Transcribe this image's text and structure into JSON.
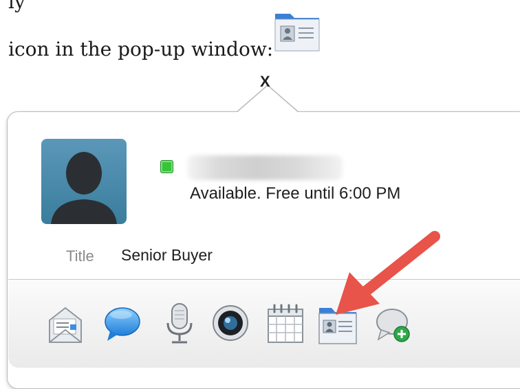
{
  "document": {
    "line1_text": "ly",
    "line2_text": "icon in the pop-up window:",
    "inline_icon": "contact-card-icon"
  },
  "popup": {
    "anchor_glyph": "X",
    "avatar_icon": "person-silhouette-icon",
    "presence_color": "#37c43a",
    "name": "",
    "status_text": "Available. Free until 6:00 PM",
    "title_label": "Title",
    "title_value": "Senior Buyer"
  },
  "toolbar": {
    "items": [
      {
        "icon": "email-icon"
      },
      {
        "icon": "chat-bubble-icon"
      },
      {
        "icon": "microphone-icon"
      },
      {
        "icon": "video-camera-icon"
      },
      {
        "icon": "calendar-icon"
      },
      {
        "icon": "contact-card-icon"
      },
      {
        "icon": "add-chat-icon"
      }
    ]
  },
  "annotation": {
    "arrow_color": "#e8534a"
  }
}
